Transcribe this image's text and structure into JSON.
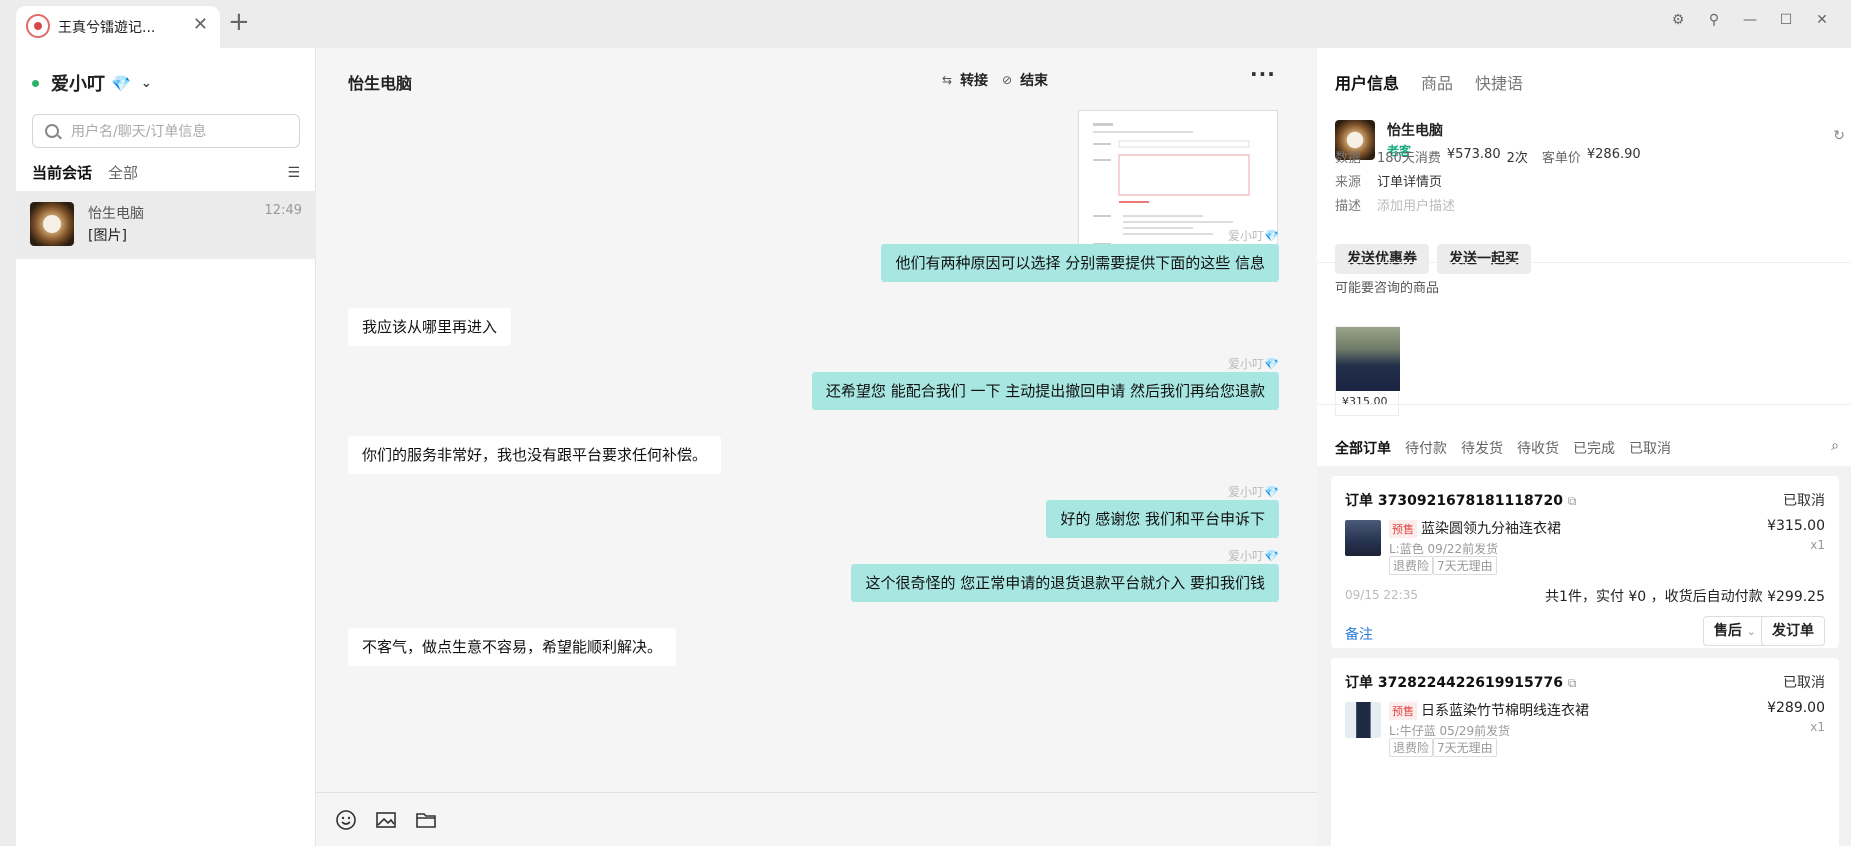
{
  "tab": {
    "title": "王真兮镭遊记...",
    "close": "✕",
    "add": "+"
  },
  "window_controls": {
    "settings": "⚙",
    "pin": "⚲",
    "minimize": "—",
    "maximize": "☐",
    "close": "✕"
  },
  "sidebar": {
    "agent_name": "爱小叮",
    "diamond": "💎",
    "chevron": "⌄",
    "search_placeholder": "用户名/聊天/订单信息",
    "tabs": {
      "current": "当前会话",
      "all": "全部",
      "sort_icon": "☰"
    },
    "conversations": [
      {
        "name": "怡生电脑",
        "time": "12:49",
        "last_message": "[图片]"
      }
    ]
  },
  "chat": {
    "title": "怡生电脑",
    "transfer_icon": "⇆",
    "transfer_label": "转接",
    "end_icon": "⊘",
    "end_label": "结束",
    "more": "···",
    "sender_label": "爱小叮💎",
    "messages": [
      {
        "dir": "out",
        "text": "他们有两种原因可以选择  分别需要提供下面的这些 信息"
      },
      {
        "dir": "in",
        "text": "我应该从哪里再进入"
      },
      {
        "dir": "out",
        "text": "还希望您 能配合我们 一下 主动提出撤回申请 然后我们再给您退款"
      },
      {
        "dir": "in",
        "text": "你们的服务非常好，我也没有跟平台要求任何补偿。"
      },
      {
        "dir": "out",
        "text": "好的 感谢您 我们和平台申诉下"
      },
      {
        "dir": "out",
        "text": "这个很奇怪的 您正常申请的退货退款平台就介入 要扣我们钱"
      },
      {
        "dir": "in",
        "text": "不客气，做点生意不容易，希望能顺利解决。"
      }
    ]
  },
  "right": {
    "tabs": [
      "用户信息",
      "商品",
      "快捷语"
    ],
    "user": {
      "name": "怡生电脑",
      "tag": "老客",
      "refresh": "↻",
      "data_key": "数据",
      "data_180": "180天消费",
      "data_amount": "¥573.80",
      "data_count": "2次",
      "data_avg_label": "客单价",
      "data_avg": "¥286.90",
      "source_key": "来源",
      "source_value": "订单详情页",
      "desc_key": "描述",
      "desc_placeholder": "添加用户描述"
    },
    "buttons": {
      "coupon": "发送优惠券",
      "group_buy": "发送一起买"
    },
    "maybe_consult": "可能要咨询的商品",
    "product": {
      "price": "¥315.00"
    },
    "order_tabs": [
      "全部订单",
      "待付款",
      "待发货",
      "待收货",
      "已完成",
      "已取消"
    ],
    "order_search": "⌕",
    "orders": [
      {
        "id": "订单 3730921678181118720",
        "copy": "⧉",
        "status": "已取消",
        "badge": "预售",
        "name": "蓝染圆领九分袖连衣裙",
        "price": "¥315.00",
        "sku": "L:蓝色 09/22前发货",
        "qty": "x1",
        "tags": [
          "退费险",
          "7天无理由"
        ],
        "time": "09/15 22:35",
        "summary": "共1件，实付 ¥0 ，收货后自动付款 ¥299.25",
        "note": "备注",
        "after_sale": "售后",
        "ship": "发订单"
      },
      {
        "id": "订单 3728224422619915776",
        "copy": "⧉",
        "status": "已取消",
        "badge": "预售",
        "name": "日系蓝染竹节棉明线连衣裙",
        "price": "¥289.00",
        "sku": "L:牛仔蓝 05/29前发货",
        "qty": "x1",
        "tags": [
          "退费险",
          "7天无理由"
        ]
      }
    ]
  }
}
